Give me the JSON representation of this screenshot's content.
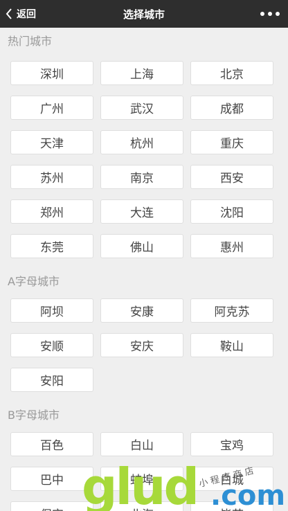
{
  "header": {
    "back_label": "返回",
    "title": "选择城市"
  },
  "sections": [
    {
      "title": "热门城市",
      "cities": [
        "深圳",
        "上海",
        "北京",
        "广州",
        "武汉",
        "成都",
        "天津",
        "杭州",
        "重庆",
        "苏州",
        "南京",
        "西安",
        "郑州",
        "大连",
        "沈阳",
        "东莞",
        "佛山",
        "惠州"
      ]
    },
    {
      "title": "A字母城市",
      "cities": [
        "阿坝",
        "安康",
        "阿克苏",
        "安顺",
        "安庆",
        "鞍山",
        "安阳"
      ]
    },
    {
      "title": "B字母城市",
      "cities": [
        "百色",
        "白山",
        "宝鸡",
        "巴中",
        "蚌埠",
        "白城",
        "保定",
        "北海",
        "毕节"
      ]
    }
  ],
  "watermark": {
    "logo": "glud",
    "suffix": ".com",
    "tagline": "小程序商店"
  }
}
